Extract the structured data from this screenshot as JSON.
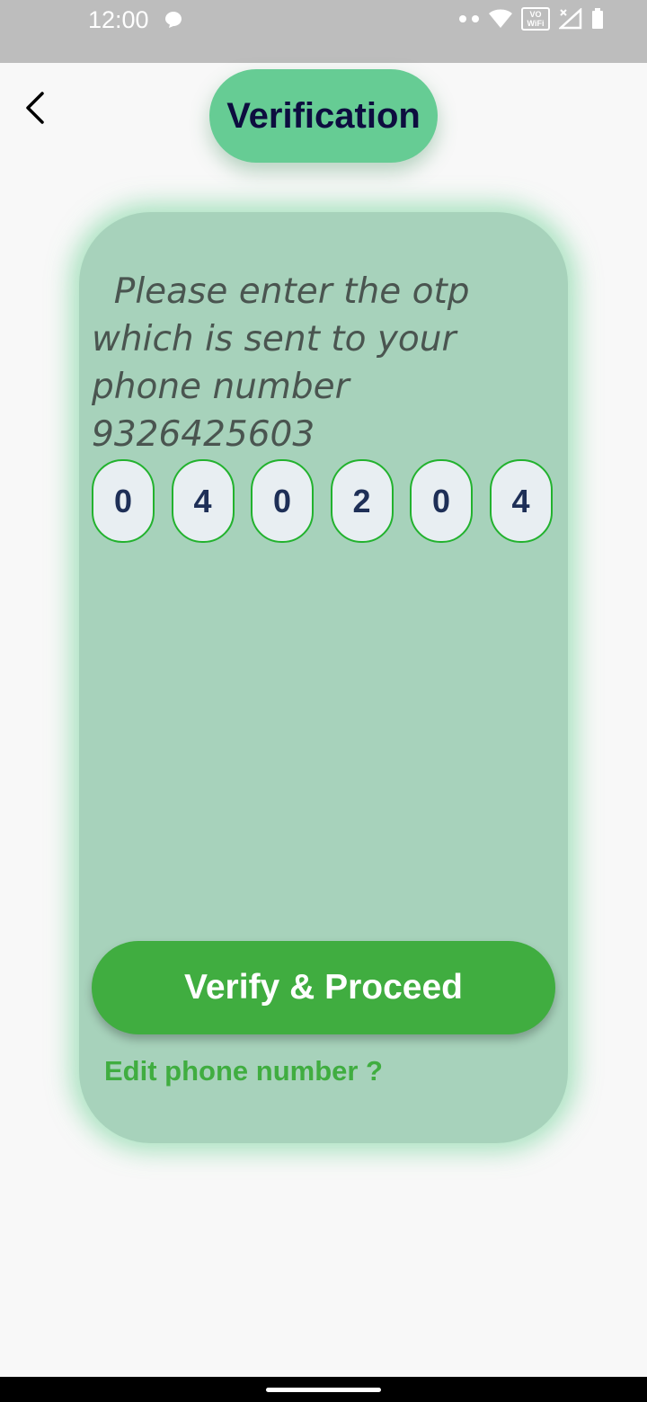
{
  "status_bar": {
    "time": "12:00",
    "icons": [
      "chat-icon",
      "dots-icon",
      "wifi-icon",
      "vowifi-icon",
      "signal-icon",
      "battery-icon"
    ],
    "vowifi_label_top": "VO",
    "vowifi_label_bottom": "WiFi"
  },
  "header": {
    "back_icon": "chevron-left-icon",
    "title": "Verification"
  },
  "card": {
    "message": "  Please enter the otp which is sent to your phone number 9326425603",
    "otp_digits": [
      "0",
      "4",
      "0",
      "2",
      "0",
      "4"
    ],
    "verify_label": "Verify & Proceed",
    "edit_label": "Edit phone number ?"
  },
  "colors": {
    "title_pill": "#66cc94",
    "card": "#a7d2bb",
    "button": "#40ad40",
    "otp_border": "#22b22e",
    "title_text": "#0d0d3f"
  }
}
